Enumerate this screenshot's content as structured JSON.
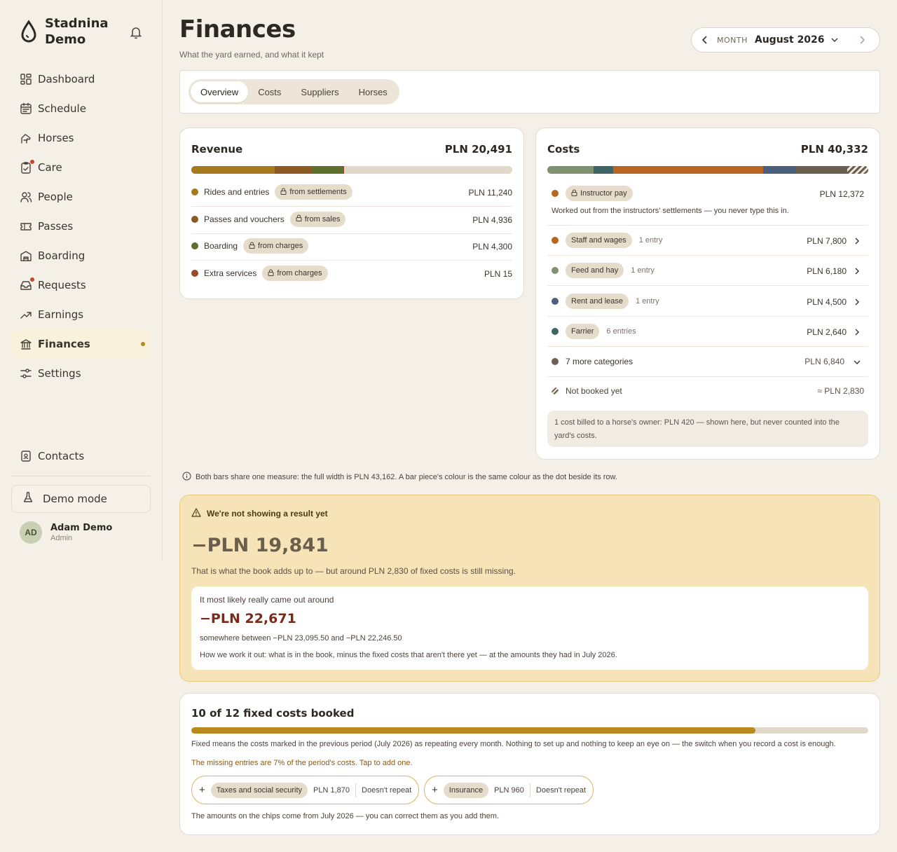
{
  "brand": {
    "name": "Stadnina Demo"
  },
  "nav": [
    {
      "label": "Dashboard",
      "icon": "dashboard-icon"
    },
    {
      "label": "Schedule",
      "icon": "calendar-icon"
    },
    {
      "label": "Horses",
      "icon": "horse-icon"
    },
    {
      "label": "Care",
      "icon": "clipboard-icon",
      "badge": true
    },
    {
      "label": "People",
      "icon": "people-icon"
    },
    {
      "label": "Passes",
      "icon": "ticket-icon"
    },
    {
      "label": "Boarding",
      "icon": "building-icon"
    },
    {
      "label": "Requests",
      "icon": "inbox-icon",
      "badge": true
    },
    {
      "label": "Earnings",
      "icon": "trend-icon"
    },
    {
      "label": "Finances",
      "icon": "bank-icon",
      "active": true
    },
    {
      "label": "Settings",
      "icon": "sliders-icon"
    }
  ],
  "contacts": "Contacts",
  "demo_mode": "Demo mode",
  "user": {
    "initials": "AD",
    "name": "Adam Demo",
    "role": "Admin"
  },
  "page": {
    "title": "Finances",
    "subtitle": "What the yard earned, and what it kept"
  },
  "month": {
    "label": "MONTH",
    "value": "August 2026"
  },
  "tabs": [
    "Overview",
    "Costs",
    "Suppliers",
    "Horses"
  ],
  "revenue": {
    "title": "Revenue",
    "total": "PLN 20,491",
    "rows": [
      {
        "label": "Rides and entries",
        "chip": "from settlements",
        "amount": "PLN 11,240",
        "value": 11240,
        "color": "#a57a1c"
      },
      {
        "label": "Passes and vouchers",
        "chip": "from sales",
        "amount": "PLN 4,936",
        "value": 4936,
        "color": "#8b5a22"
      },
      {
        "label": "Boarding",
        "chip": "from charges",
        "amount": "PLN 4,300",
        "value": 4300,
        "color": "#5e6e2c"
      },
      {
        "label": "Extra services",
        "chip": "from charges",
        "amount": "PLN 15",
        "value": 15,
        "color": "#9a4a2c"
      }
    ]
  },
  "costs": {
    "title": "Costs",
    "total": "PLN 40,332",
    "instructor": {
      "chip": "Instructor pay",
      "amount": "PLN 12,372",
      "note": "Worked out from the instructors' settlements — you never type this in."
    },
    "rows": [
      {
        "chip": "Staff and wages",
        "entries": "1 entry",
        "amount": "PLN 7,800",
        "color": "#b8661f"
      },
      {
        "chip": "Feed and hay",
        "entries": "1 entry",
        "amount": "PLN 6,180",
        "color": "#7f9270"
      },
      {
        "chip": "Rent and lease",
        "entries": "1 entry",
        "amount": "PLN 4,500",
        "color": "#4c5f7c"
      },
      {
        "chip": "Farrier",
        "entries": "6 entries",
        "amount": "PLN 2,640",
        "color": "#3f6466"
      }
    ],
    "more": {
      "label": "7 more categories",
      "amount": "PLN 6,840",
      "color": "#6b5f50"
    },
    "unbooked": {
      "label": "Not booked yet",
      "amount": "≈ PLN 2,830"
    },
    "billed_note": "1 cost billed to a horse's owner: PLN 420 — shown here, but never counted into the yard's costs.",
    "bar": [
      {
        "value": 6180,
        "color": "#7f9270"
      },
      {
        "value": 2640,
        "color": "#3f6466"
      },
      {
        "value": 12372,
        "color": "#b8661f"
      },
      {
        "value": 7800,
        "color": "#b8661f"
      },
      {
        "value": 4500,
        "color": "#4c5f7c"
      },
      {
        "value": 6840,
        "color": "#6b5f50"
      },
      {
        "value": 2830,
        "color": "hatch"
      }
    ]
  },
  "scale_note": "Both bars share one measure: the full width is PLN 43,162. A bar piece's colour is the same colour as the dot beside its row.",
  "scale_max": 43162,
  "result": {
    "warning": "We're not showing a result yet",
    "book_total": "−PLN 19,841",
    "book_note": "That is what the book adds up to — but around PLN 2,830 of fixed costs is still missing.",
    "estimate_label": "It most likely really came out around",
    "estimate": "−PLN 22,671",
    "range": "somewhere between −PLN 23,095.50 and −PLN 22,246.50",
    "method": "How we work it out: what is in the book, minus the fixed costs that aren't there yet — at the amounts they had in July 2026."
  },
  "fixed": {
    "title": "10 of 12 fixed costs booked",
    "progress": 0.8333,
    "desc": "Fixed means the costs marked in the previous period (July 2026) as repeating every month. Nothing to set up and nothing to keep an eye on — the switch when you record a cost is enough.",
    "missing": "The missing entries are 7% of the period's costs. Tap to add one.",
    "pills": [
      {
        "chip": "Taxes and social security",
        "amount": "PLN 1,870",
        "repeat": "Doesn't repeat"
      },
      {
        "chip": "Insurance",
        "amount": "PLN 960",
        "repeat": "Doesn't repeat"
      }
    ],
    "footer": "The amounts on the chips come from July 2026 — you can correct them as you add them."
  },
  "colors": {
    "accent": "#b88a1e",
    "negative": "#7a2a1a",
    "warning_bg": "#f6e4b8"
  }
}
